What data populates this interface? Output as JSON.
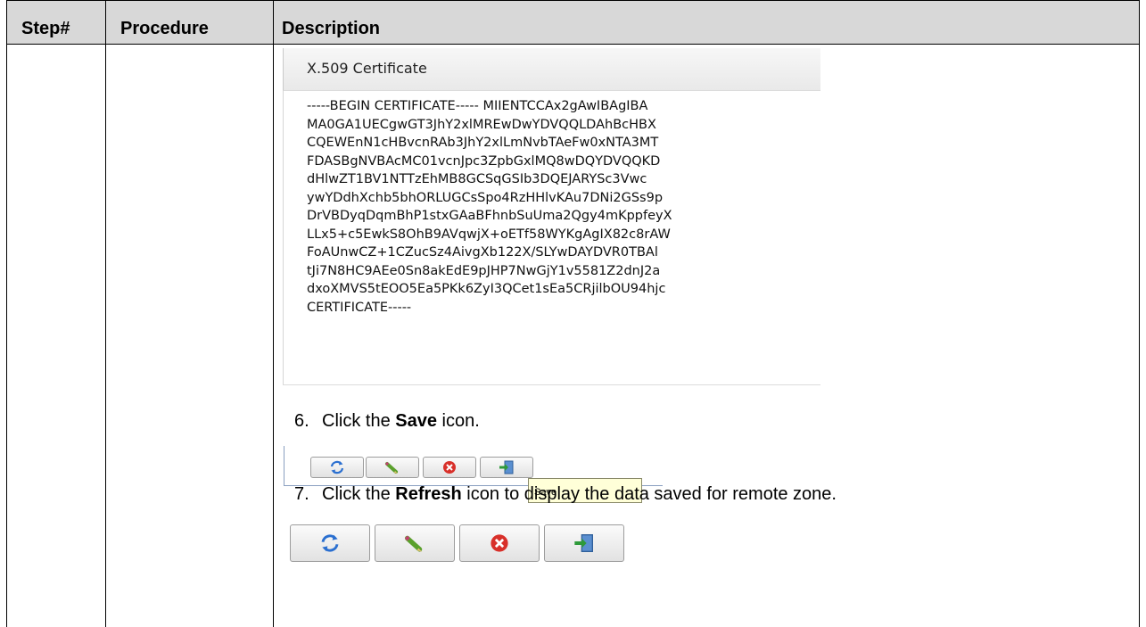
{
  "table": {
    "headers": [
      "Step#",
      "Procedure",
      "Description"
    ]
  },
  "certificate": {
    "title": "X.509 Certificate",
    "lines": [
      "-----BEGIN CERTIFICATE----- MIIENTCCAx2gAwIBAgIBA",
      "MA0GA1UECgwGT3JhY2xlMREwDwYDVQQLDAhBcHBX",
      "CQEWEnN1cHBvcnRAb3JhY2xlLmNvbTAeFw0xNTA3MT",
      "FDASBgNVBAcMC01vcnJpc3ZpbGxlMQ8wDQYDVQQKD",
      "dHlwZT1BV1NTTzEhMB8GCSqGSIb3DQEJARYSc3Vwc",
      "ywYDdhXchb5bhORLUGCsSpo4RzHHlvKAu7DNi2GSs9p",
      "DrVBDyqDqmBhP1stxGAaBFhnbSuUma2Qgy4mKppfeyX",
      "LLx5+c5EwkS8OhB9AVqwjX+oETf58WYKgAgIX82c8rAW",
      "FoAUnwCZ+1CZucSz4AivgXb122X/SLYwDAYDVR0TBAl",
      "tJi7N8HC9AEe0Sn8akEdE9pJHP7NwGjY1v5581Z2dnJ2a",
      "dxoXMVS5tEOO5Ea5PKk6ZyI3QCet1sEa5CRjilbOU94hjc",
      "CERTIFICATE-----"
    ]
  },
  "steps": [
    {
      "number": "6.",
      "pre": "Click the ",
      "bold": "Save",
      "post": " icon."
    },
    {
      "number": "7.",
      "pre": "Click the ",
      "bold": "Refresh",
      "post": " icon to display the data saved for remote zone."
    }
  ],
  "toolbar": {
    "buttons": [
      "refresh-icon",
      "edit-pencil-icon",
      "delete-icon",
      "save-icon"
    ],
    "tooltip": "Save"
  }
}
